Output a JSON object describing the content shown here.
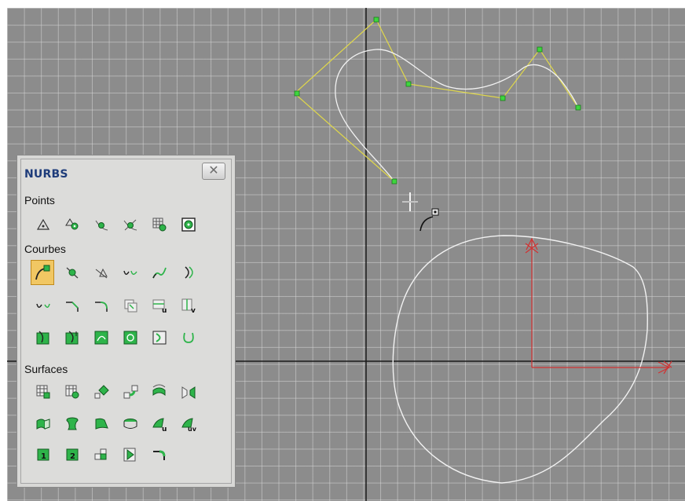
{
  "panel": {
    "title": "NURBS",
    "close_icon": "close-icon",
    "sections": [
      {
        "label": "Points",
        "tools": [
          "point-icon",
          "offset-point-icon",
          "curve-point-icon",
          "curve-curve-point-icon",
          "surface-point-icon",
          "surface-curve-point-icon"
        ]
      },
      {
        "label": "Courbes",
        "tools": [
          "cv-curve-icon",
          "point-curve-icon",
          "fit-curve-icon",
          "transform-curve-icon",
          "blend-curve-icon",
          "offset-curve-icon",
          "mirror-curve-icon",
          "chamfer-curve-icon",
          "fillet-curve-icon",
          "surface-surface-intersection-icon",
          "u-iso-curve-icon",
          "v-iso-curve-icon",
          "normal-projected-curve-icon",
          "vector-projected-curve-icon",
          "cv-curve-on-surface-icon",
          "point-curve-on-surface-icon",
          "surface-offset-curve-icon",
          "surface-edge-curve-icon"
        ],
        "selected_index": 0
      },
      {
        "label": "Surfaces",
        "tools": [
          "cv-surface-icon",
          "point-surface-icon",
          "transform-surface-icon",
          "blend-surface-icon",
          "offset-surface-icon",
          "mirror-surface-icon",
          "extrude-surface-icon",
          "lathe-surface-icon",
          "ruled-surface-icon",
          "cap-surface-icon",
          "u-loft-surface-icon",
          "uv-loft-surface-icon",
          "one-rail-sweep-icon",
          "two-rail-sweep-icon",
          "multisided-blend-icon",
          "multicurve-trimmed-surface-icon",
          "fillet-surface-icon"
        ]
      }
    ]
  },
  "scene": {
    "curve_color": "#f0f0f0",
    "control_polygon_color": "#e8e04a",
    "control_point_color": "#3ed63e",
    "axis_color": "#d13232",
    "grid_color": "#d6d6d6",
    "background_color": "#8c8c8c"
  }
}
